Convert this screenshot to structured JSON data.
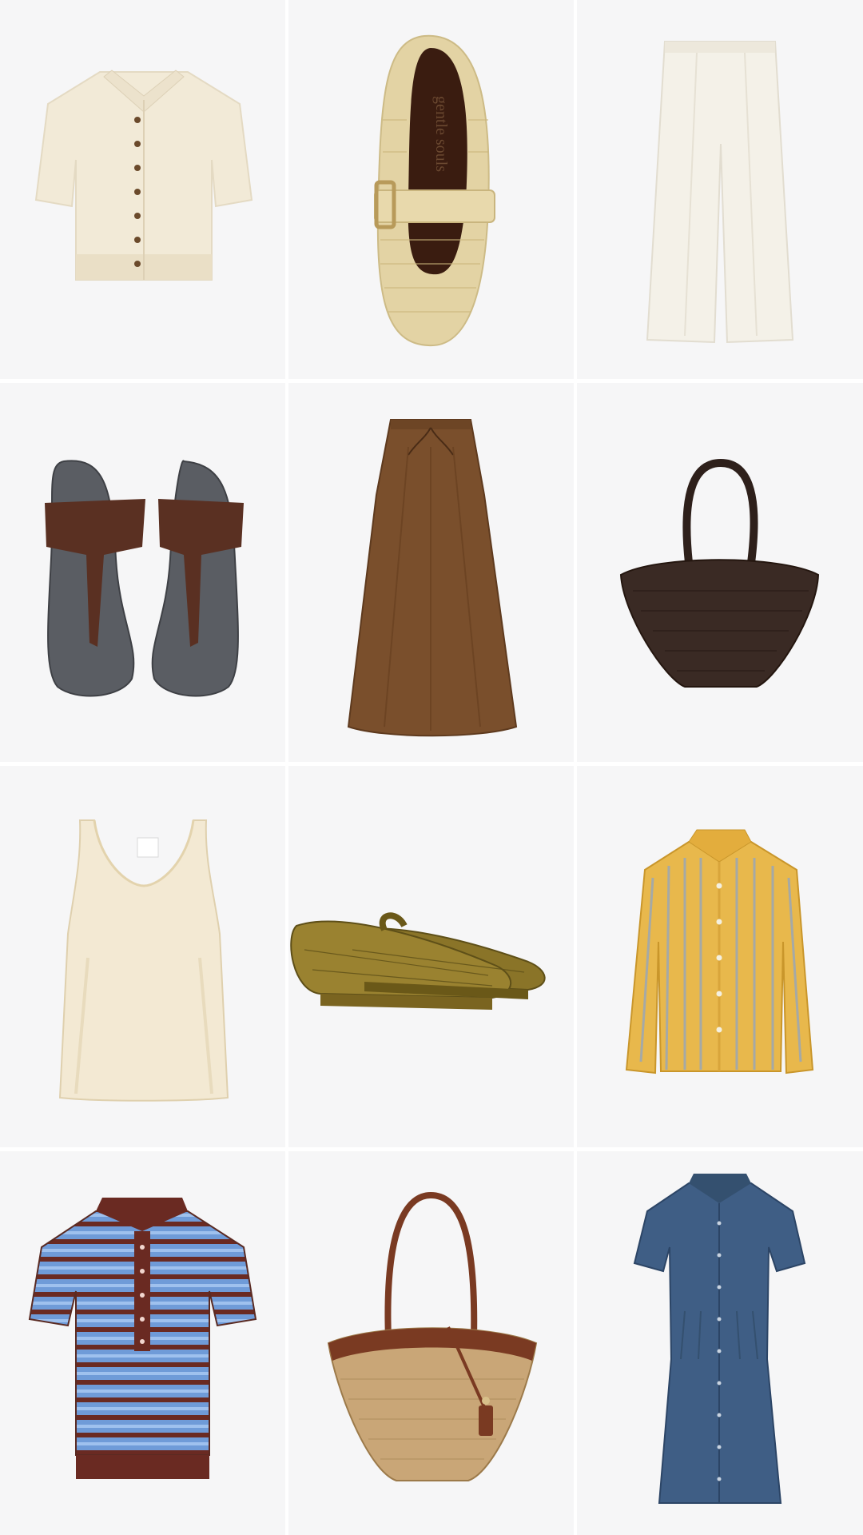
{
  "grid": {
    "columns": 3,
    "rows": 4,
    "items": [
      {
        "name": "cream-knit-polo-cardigan",
        "colors": {
          "main": "#f2ead7",
          "accent": "#6b4a2b"
        }
      },
      {
        "name": "woven-raffia-mary-jane-flat",
        "colors": {
          "main": "#e3d3a4",
          "accent": "#3a1c10"
        },
        "logo_text": "gentle souls"
      },
      {
        "name": "white-wide-leg-trousers",
        "colors": {
          "main": "#f4f1e8",
          "accent": "#e2ddd0"
        }
      },
      {
        "name": "brown-suede-thong-sandals",
        "colors": {
          "main": "#5a5d63",
          "accent": "#5a3022"
        }
      },
      {
        "name": "brown-midi-skirt",
        "colors": {
          "main": "#7a4f2c",
          "accent": "#5e3a1e"
        }
      },
      {
        "name": "dark-brown-woven-tote",
        "colors": {
          "main": "#3a2a24",
          "accent": "#2a1c18"
        }
      },
      {
        "name": "cream-satin-tank-top",
        "colors": {
          "main": "#f3e9d3",
          "accent": "#e8d9b9"
        }
      },
      {
        "name": "olive-crochet-espadrilles",
        "colors": {
          "main": "#8a7428",
          "accent": "#6a5818"
        }
      },
      {
        "name": "yellow-striped-button-shirt",
        "colors": {
          "main": "#e8b84c",
          "accent": "#9aa7b6"
        }
      },
      {
        "name": "blue-brown-striped-polo",
        "colors": {
          "main": "#6f9bd8",
          "accent": "#6a2a22"
        }
      },
      {
        "name": "straw-tote-leather-trim",
        "colors": {
          "main": "#c9a677",
          "accent": "#7a3a22"
        }
      },
      {
        "name": "denim-shirt-dress",
        "colors": {
          "main": "#3f5e85",
          "accent": "#2c4566"
        }
      }
    ]
  }
}
